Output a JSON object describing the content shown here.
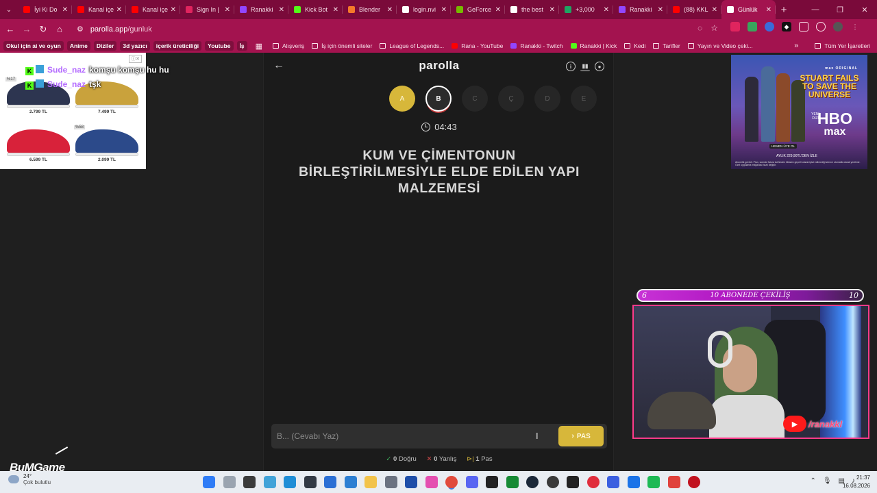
{
  "browser": {
    "tabs": [
      {
        "label": "İyi Ki Do",
        "icon": "youtube-icon",
        "color": "#ff0000"
      },
      {
        "label": "Kanal içe",
        "icon": "youtube-icon",
        "color": "#ff0000"
      },
      {
        "label": "Kanal içe",
        "icon": "youtube-icon",
        "color": "#ff0000"
      },
      {
        "label": "Sign In |",
        "icon": "signin-icon",
        "color": "#e0245e"
      },
      {
        "label": "Ranakki",
        "icon": "twitch-icon",
        "color": "#9146ff"
      },
      {
        "label": "Kick Bot",
        "icon": "kick-icon",
        "color": "#53fc18"
      },
      {
        "label": "Blender",
        "icon": "blender-icon",
        "color": "#f5792a"
      },
      {
        "label": "login.nvi",
        "icon": "globe-icon",
        "color": "#ffffff"
      },
      {
        "label": "GeForce",
        "icon": "nvidia-icon",
        "color": "#76b900"
      },
      {
        "label": "the best",
        "icon": "google-icon",
        "color": "#ffffff"
      },
      {
        "label": "+3,000",
        "icon": "sheet-icon",
        "color": "#1fa463"
      },
      {
        "label": "Ranakki",
        "icon": "twitch-icon",
        "color": "#9146ff"
      },
      {
        "label": "(88) KKL",
        "icon": "youtube-icon",
        "color": "#ff0000"
      },
      {
        "label": "Günlük",
        "icon": "globe-icon",
        "color": "#ffffff",
        "active": true
      }
    ],
    "new_tab": "+",
    "url_host": "parolla.app",
    "url_path": "/gunluk",
    "bookmark_chips": [
      "Okul için ai ve oyun",
      "Anime",
      "Diziler",
      "3d yazıcı",
      "içerik üreticiliği",
      "Youtube",
      "İş"
    ],
    "bookmarks": [
      {
        "label": "Alışveriş",
        "type": "folder"
      },
      {
        "label": "İş için önemli siteler",
        "type": "folder"
      },
      {
        "label": "League of Legends...",
        "type": "folder"
      },
      {
        "label": "Rana - YouTube",
        "type": "youtube"
      },
      {
        "label": "Ranakki - Twitch",
        "type": "twitch"
      },
      {
        "label": "Ranakki | Kick",
        "type": "kick"
      },
      {
        "label": "Kedi",
        "type": "folder"
      },
      {
        "label": "Tarifler",
        "type": "folder"
      },
      {
        "label": "Yayın ve Video çeki...",
        "type": "folder"
      }
    ],
    "bookmarks_more": "»",
    "all_bookmarks": "Tüm Yer İşaretleri"
  },
  "game": {
    "logo": "parolla",
    "letters": [
      {
        "letter": "A",
        "state": "done"
      },
      {
        "letter": "B",
        "state": "current"
      },
      {
        "letter": "C",
        "state": "pending"
      },
      {
        "letter": "Ç",
        "state": "pending"
      },
      {
        "letter": "D",
        "state": "pending"
      },
      {
        "letter": "E",
        "state": "pending"
      }
    ],
    "timer": "04:43",
    "question": "KUM VE ÇİMENTONUN BİRLEŞTİRİLMESİYLE ELDE EDİLEN YAPI MALZEMESİ",
    "answer_placeholder": "B... (Cevabı Yaz)",
    "pass_label": "PAS",
    "stats": {
      "correct_count": "0",
      "correct_label": "Doğru",
      "wrong_count": "0",
      "wrong_label": "Yanlış",
      "pass_count": "1",
      "pass_label": "Pas"
    }
  },
  "left_ad": {
    "products": [
      {
        "discount": "%17",
        "price": "2.799 TL",
        "color": "#2d3550"
      },
      {
        "discount": "",
        "price": "7.499 TL",
        "color": "#c9a23c"
      },
      {
        "discount": "",
        "price": "6.599 TL",
        "color": "#d8223a"
      },
      {
        "discount": "%58",
        "price": "2.099 TL",
        "color": "#2c4a8a"
      }
    ]
  },
  "chat": [
    {
      "user": "Sude_naz",
      "message": "komşu komşu hu hu"
    },
    {
      "user": "Sude_naz",
      "message": "tşk"
    }
  ],
  "right_ad": {
    "network": "max ORIGINAL",
    "title": "STUART FAILS TO SAVE THE UNIVERSE",
    "badge": "YENİ DİZİ",
    "logo_top": "HBO",
    "logo_bottom": "max",
    "cta": "HEMEN ÜYE OL",
    "price": "AYLIK 229,90TL'DEN İZLE",
    "legal": "Abonelik gerekli. Plan, sonraki fatura tarihinden itibaren geçerli olarak iptal edilmediği sürece otomatik olarak yenilenir. Özel uygulama mağazası bazlı değişir."
  },
  "stream": {
    "goal_current": "6",
    "goal_title": "10 ABONEDE ÇEKİLİŞ",
    "goal_target": "10",
    "goal_fraction": 0.6,
    "channel_name": "/ranakkl",
    "corner_logo": "BuMGame"
  },
  "taskbar": {
    "weather_temp": "24°",
    "weather_desc": "Çok bulutlu",
    "time": "21:37",
    "date": "16.08.2026",
    "apps": [
      {
        "name": "start-icon",
        "color": "#2f7cf6"
      },
      {
        "name": "search-icon",
        "color": "#9aa4b0"
      },
      {
        "name": "task-view-icon",
        "color": "#3b3b3b"
      },
      {
        "name": "photos-icon",
        "color": "#41a3d8"
      },
      {
        "name": "edge-icon",
        "color": "#1f8ed6"
      },
      {
        "name": "cube-icon",
        "color": "#333a44"
      },
      {
        "name": "store-icon",
        "color": "#2b6fd4"
      },
      {
        "name": "mail-icon",
        "color": "#2d7fd2"
      },
      {
        "name": "folder-icon",
        "color": "#f2c34a"
      },
      {
        "name": "settings-icon",
        "color": "#6b7280"
      },
      {
        "name": "photoshop-icon",
        "color": "#1e4ea8"
      },
      {
        "name": "gallery-icon",
        "color": "#e44fb0"
      },
      {
        "name": "chrome-icon",
        "color": "#e14b3c"
      },
      {
        "name": "discord-icon",
        "color": "#5865f2"
      },
      {
        "name": "obs-icon",
        "color": "#222222"
      },
      {
        "name": "xbox-icon",
        "color": "#168a34"
      },
      {
        "name": "steam-icon",
        "color": "#1b2838"
      },
      {
        "name": "circle-app-icon",
        "color": "#3a3a3a"
      },
      {
        "name": "epic-icon",
        "color": "#222222"
      },
      {
        "name": "red-app-icon",
        "color": "#e02d3c"
      },
      {
        "name": "vpn-icon",
        "color": "#3b5fe0"
      },
      {
        "name": "blue-app-icon",
        "color": "#1a73e8"
      },
      {
        "name": "spotify-icon",
        "color": "#1db954"
      },
      {
        "name": "game-icon",
        "color": "#e0413b"
      },
      {
        "name": "record-icon",
        "color": "#c1121f"
      }
    ]
  }
}
